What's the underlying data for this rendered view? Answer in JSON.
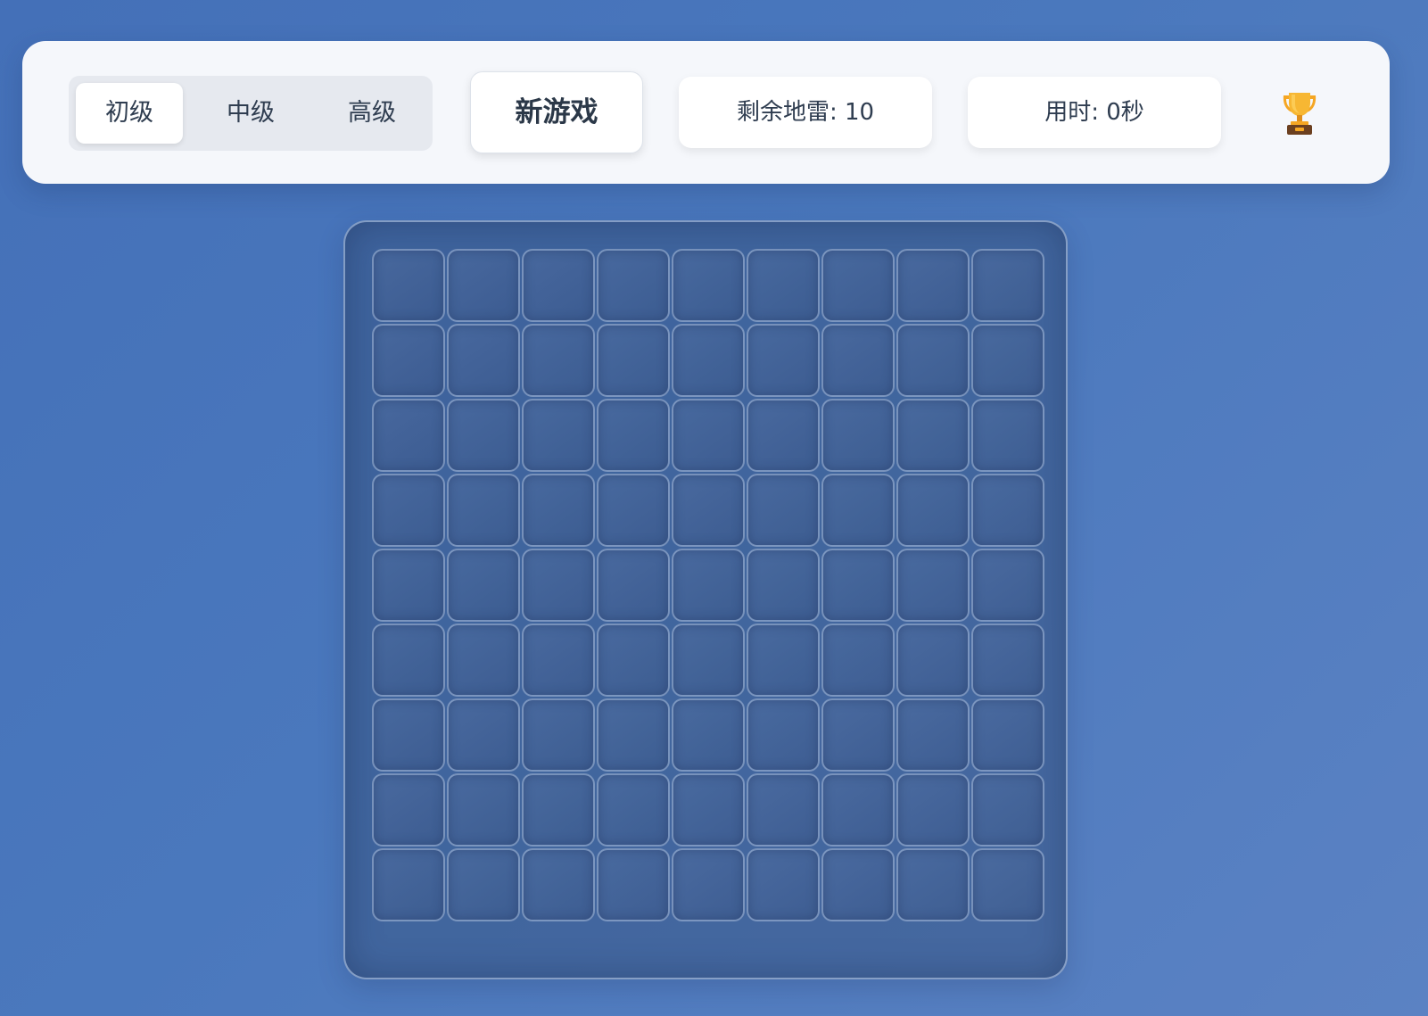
{
  "toolbar": {
    "difficulty": [
      {
        "label": "初级",
        "active": true
      },
      {
        "label": "中级",
        "active": false
      },
      {
        "label": "高级",
        "active": false
      }
    ],
    "new_game_label": "新游戏",
    "mines_remaining": "剩余地雷: 10",
    "time_elapsed": "用时: 0秒",
    "trophy_icon": "trophy-icon"
  },
  "board": {
    "rows": 9,
    "cols": 9,
    "cell_state": "unrevealed"
  },
  "colors": {
    "background": "#4a78bd",
    "toolbar": "#f5f7fb",
    "text": "#2f3d50",
    "trophy_gold": "#f5a623",
    "trophy_base": "#6b3f1f"
  }
}
